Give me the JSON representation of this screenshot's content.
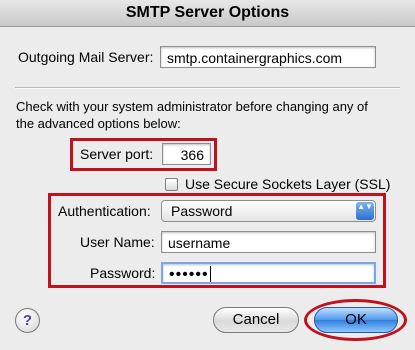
{
  "window": {
    "title": "SMTP Server Options"
  },
  "outgoing": {
    "label": "Outgoing Mail Server:",
    "value": "smtp.containergraphics.com"
  },
  "notice": {
    "line1": "Check with your system administrator before changing any of",
    "line2": "the advanced options below:"
  },
  "port": {
    "label": "Server port:",
    "value": "366"
  },
  "ssl": {
    "label": "Use Secure Sockets Layer (SSL)",
    "checked": false
  },
  "auth": {
    "label": "Authentication:",
    "selected": "Password",
    "arrows": "▲▼"
  },
  "username": {
    "label": "User Name:",
    "value": "username"
  },
  "password": {
    "label": "Password:",
    "masked": "••••••"
  },
  "buttons": {
    "help": "?",
    "cancel": "Cancel",
    "ok": "OK"
  },
  "colors": {
    "highlight": "#c0121c",
    "default_button": "#2f7ee0"
  }
}
